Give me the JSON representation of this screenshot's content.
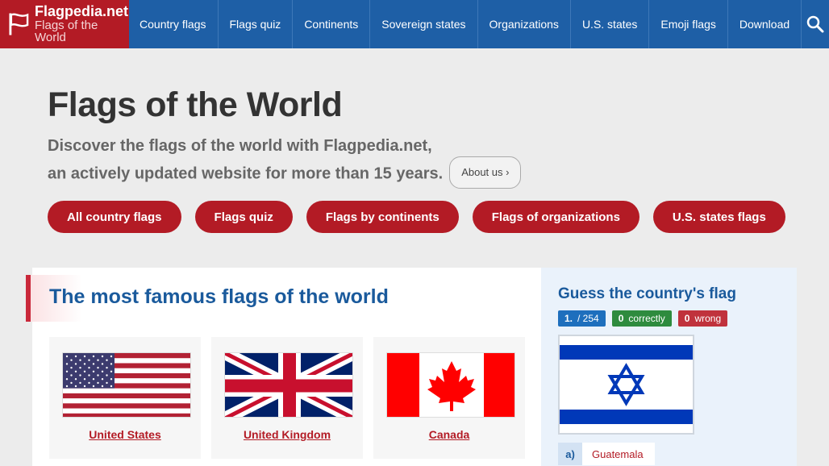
{
  "header": {
    "site_name": "Flagpedia.net",
    "tagline": "Flags of the World",
    "nav": [
      "Country flags",
      "Flags quiz",
      "Continents",
      "Sovereign states",
      "Organizations",
      "U.S. states",
      "Emoji flags",
      "Download"
    ],
    "search_icon": "search-icon",
    "brand_color": "#b31b25",
    "nav_color": "#1e5fa6"
  },
  "hero": {
    "title": "Flags of the World",
    "subtitle_line1": "Discover the flags of the world with Flagpedia.net,",
    "subtitle_line2": "an actively updated website for more than 15 years.",
    "about_label": "About us",
    "buttons": [
      "All country flags",
      "Flags quiz",
      "Flags by continents",
      "Flags of organizations",
      "U.S. states flags"
    ]
  },
  "famous": {
    "title": "The most famous flags of the world",
    "flags": [
      {
        "name": "United States"
      },
      {
        "name": "United Kingdom"
      },
      {
        "name": "Canada"
      }
    ]
  },
  "quiz": {
    "title": "Guess the country's flag",
    "question_num": "1.",
    "question_total": "/ 254",
    "correct_count": "0",
    "correct_label": "correctly",
    "wrong_count": "0",
    "wrong_label": "wrong",
    "answer_key": "a)",
    "answer_text": "Guatemala"
  }
}
